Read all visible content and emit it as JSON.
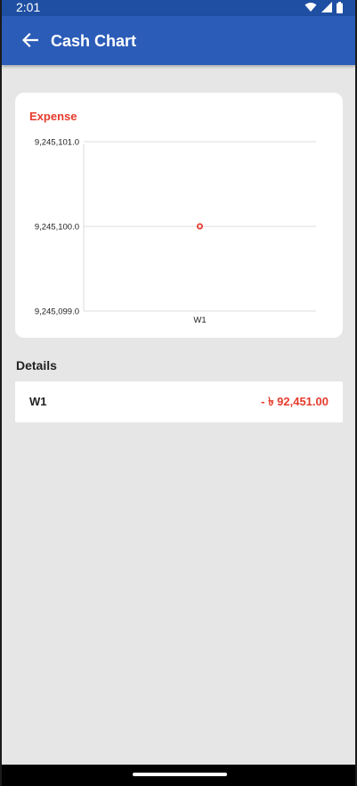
{
  "status_bar": {
    "time": "2:01"
  },
  "app_bar": {
    "title": "Cash Chart"
  },
  "colors": {
    "primary": "#2b5cb8",
    "status_bar": "#1f4fa3",
    "expense": "#e53b2c",
    "background": "#e6e6e6"
  },
  "chart_card": {
    "title": "Expense"
  },
  "chart_data": {
    "type": "line",
    "title": "Expense",
    "categories": [
      "W1"
    ],
    "series": [
      {
        "values": [
          9245100.0
        ]
      }
    ],
    "y_ticks": [
      "9,245,101.0",
      "9,245,100.0",
      "9,245,099.0"
    ],
    "ylim": [
      9245099.0,
      9245101.0
    ],
    "grid": true
  },
  "details": {
    "title": "Details",
    "rows": [
      {
        "label": "W1",
        "amount": "- ৳ 92,451.00"
      }
    ]
  }
}
